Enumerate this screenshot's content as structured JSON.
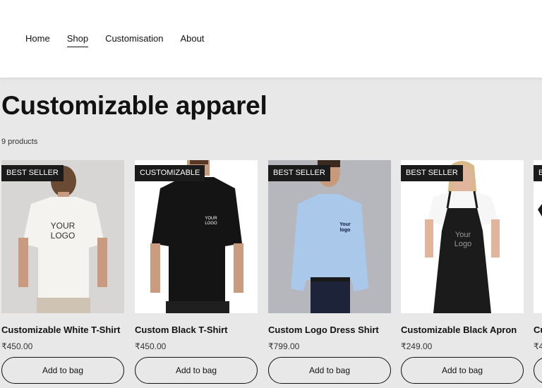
{
  "nav": {
    "items": [
      {
        "label": "Home"
      },
      {
        "label": "Shop"
      },
      {
        "label": "Customisation"
      },
      {
        "label": "About"
      }
    ]
  },
  "page": {
    "title": "Customizable apparel",
    "count": "9 products"
  },
  "products": [
    {
      "badge": "BEST SELLER",
      "name": "Customizable White T-Shirt",
      "price": "₹450.00",
      "button": "Add to bag",
      "logo": "YOUR LOGO"
    },
    {
      "badge": "CUSTOMIZABLE",
      "name": "Custom Black T-Shirt",
      "price": "₹450.00",
      "button": "Add to bag",
      "logo": "YOUR LOGO"
    },
    {
      "badge": "BEST SELLER",
      "name": "Custom Logo Dress Shirt",
      "price": "₹799.00",
      "button": "Add to bag",
      "logo": "Your logo"
    },
    {
      "badge": "BEST SELLER",
      "name": "Customizable Black Apron",
      "price": "₹249.00",
      "button": "Add to bag",
      "logo": "Your Logo"
    },
    {
      "badge": "B",
      "name": "Cu",
      "price": "₹4",
      "button": ""
    }
  ],
  "colors": {
    "page_bg": "#e8e8e8",
    "header_bg": "#ffffff",
    "badge_bg": "#1b1b1b",
    "text": "#121212"
  }
}
